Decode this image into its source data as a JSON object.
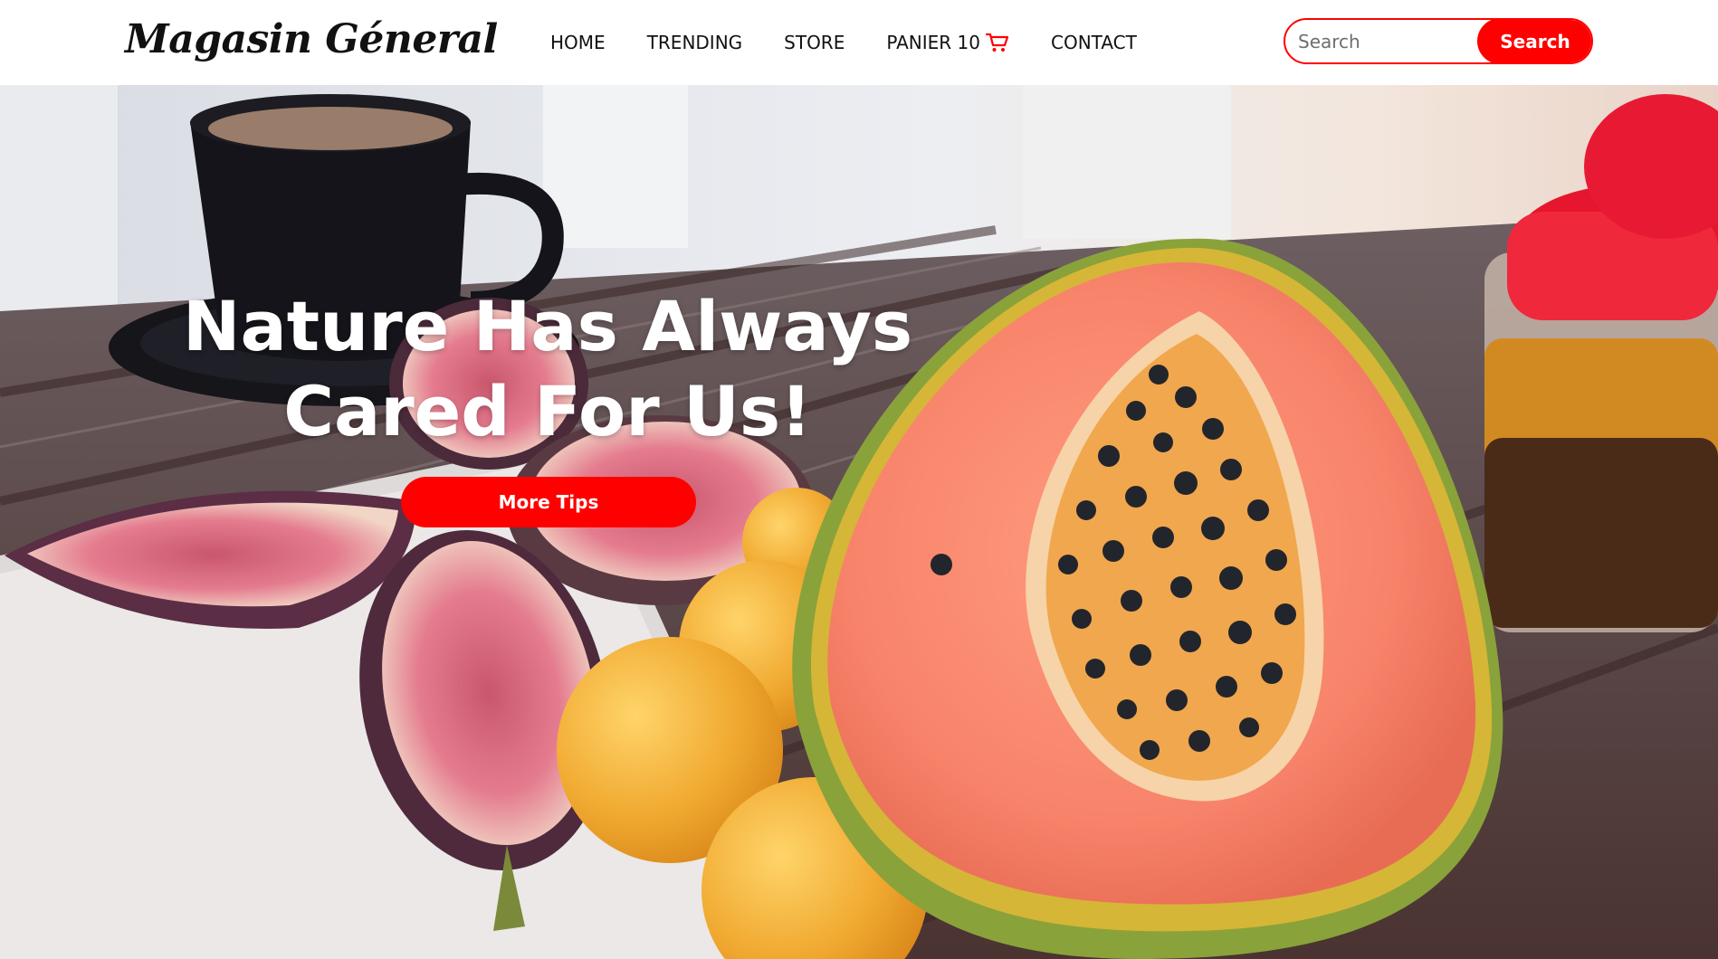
{
  "brand": {
    "logo_text": "Magasin Géneral"
  },
  "nav": {
    "items": [
      {
        "label": "HOME"
      },
      {
        "label": "TRENDING"
      },
      {
        "label": "STORE"
      },
      {
        "label": "PANIER 10",
        "icon": "shopping-cart-icon"
      },
      {
        "label": "CONTACT"
      }
    ]
  },
  "search": {
    "placeholder": "Search",
    "value": "",
    "button_label": "Search"
  },
  "hero": {
    "title_line1": "Nature Has Always",
    "title_line2": "Cared For Us!",
    "cta_label": "More Tips"
  },
  "colors": {
    "accent": "#ff0000",
    "text_dark": "#111111",
    "hero_text": "#ffffff"
  }
}
